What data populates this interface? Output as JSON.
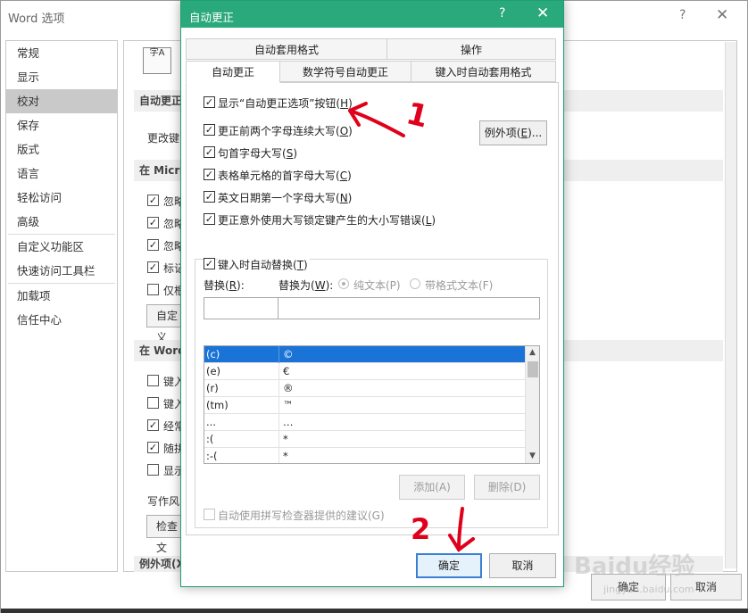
{
  "background_window": {
    "title": "Word 选项",
    "help": "?",
    "close": "✕",
    "nav": [
      "常规",
      "显示",
      "校对",
      "保存",
      "版式",
      "语言",
      "轻松访问",
      "高级",
      "自定义功能区",
      "快速访问工具栏",
      "加载项",
      "信任中心"
    ],
    "nav_selected": "校对",
    "sections": {
      "autocorrect": "自动更正",
      "autocorrect_desc": "更改键",
      "in_ms": "在 Micro",
      "in_word": "在 Word",
      "exceptions": "例外项(X"
    },
    "ignore_items": [
      "忽略",
      "忽略",
      "忽略",
      "标记",
      "仅根"
    ],
    "custom_btn": "自定义",
    "word_items": [
      "键入",
      "键入",
      "经常",
      "随拼",
      "显示"
    ],
    "style_label": "写作风",
    "check_btn": "检查文",
    "icon_text": "字A",
    "ok": "确定",
    "cancel": "取消"
  },
  "dialog": {
    "title": "自动更正",
    "help": "?",
    "close": "✕",
    "tabs_row1": [
      "自动套用格式",
      "操作"
    ],
    "tabs_row2": [
      "自动更正",
      "数学符号自动更正",
      "键入时自动套用格式"
    ],
    "active_tab": "自动更正",
    "options": [
      {
        "label": "显示“自动更正选项”按钮(",
        "key": "H",
        "end": ")",
        "checked": true
      },
      {
        "label": "更正前两个字母连续大写(",
        "key": "O",
        "end": ")",
        "checked": true
      },
      {
        "label": "句首字母大写(",
        "key": "S",
        "end": ")",
        "checked": true
      },
      {
        "label": "表格单元格的首字母大写(",
        "key": "C",
        "end": ")",
        "checked": true
      },
      {
        "label": "英文日期第一个字母大写(",
        "key": "N",
        "end": ")",
        "checked": true
      },
      {
        "label": "更正意外使用大写锁定键产生的大小写错误(",
        "key": "L",
        "end": ")",
        "checked": true
      }
    ],
    "exceptions_button": {
      "label": "例外项(",
      "key": "E",
      "end": ")..."
    },
    "replace_as_type": {
      "label": "键入时自动替换(",
      "key": "T",
      "end": ")",
      "checked": true
    },
    "replace_label": {
      "label": "替换(",
      "key": "R",
      "end": "):"
    },
    "with_label": {
      "label": "替换为(",
      "key": "W",
      "end": "):"
    },
    "plain_text": "纯文本(P)",
    "formatted_text": "带格式文本(F)",
    "replace_value": "",
    "with_value": "",
    "entries": [
      {
        "from": "(c)",
        "to": "©"
      },
      {
        "from": "(e)",
        "to": "€"
      },
      {
        "from": "(r)",
        "to": "®"
      },
      {
        "from": "(tm)",
        "to": "™"
      },
      {
        "from": "...",
        "to": "…"
      },
      {
        "from": ":(",
        "to": "*"
      },
      {
        "from": ":-(",
        "to": "*"
      }
    ],
    "selected_entry": 0,
    "add_button": "添加(A)",
    "delete_button": "删除(D)",
    "spell_suggestions": "自动使用拼写检查器提供的建议(G)",
    "ok": "确定",
    "cancel": "取消"
  },
  "annotations": {
    "step1": "1",
    "step2": "2",
    "color": "#e0001b"
  },
  "watermark": {
    "brand": "Baidu经验",
    "url": "jingyan.baidu.com"
  },
  "colors": {
    "dialog_title_bar": "#2aa97c",
    "selection": "#1a73d6",
    "default_button_border": "#3b7fd4"
  }
}
